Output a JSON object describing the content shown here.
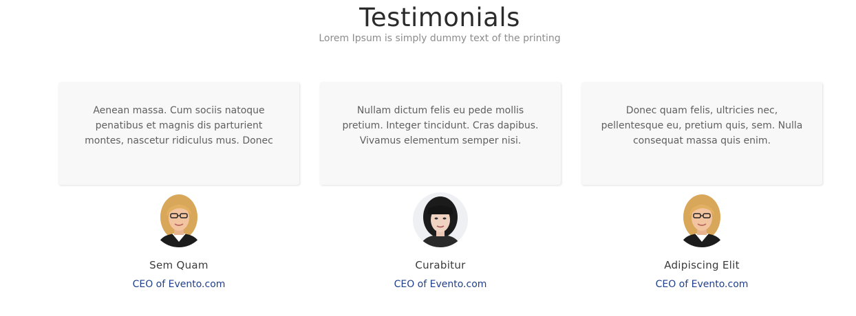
{
  "section": {
    "title": "Testimonials",
    "subtitle": "Lorem Ipsum is simply dummy text of the printing"
  },
  "testimonials": [
    {
      "quote": "Aenean massa. Cum sociis natoque penatibus et magnis dis parturient montes, nascetur ridiculus mus. Donec",
      "name": "Sem Quam",
      "role": "CEO of Evento.com",
      "avatar": "blonde-woman-glasses-photo"
    },
    {
      "quote": "Nullam dictum felis eu pede mollis pretium. Integer tincidunt. Cras dapibus. Vivamus elementum semper nisi.",
      "name": "Curabitur",
      "role": "CEO of Evento.com",
      "avatar": "dark-hair-woman-photo"
    },
    {
      "quote": "Donec quam felis, ultricies nec, pellentesque eu, pretium quis, sem. Nulla consequat massa quis enim.",
      "name": "Adipiscing Elit",
      "role": "CEO of Evento.com",
      "avatar": "blonde-woman-glasses-photo"
    }
  ],
  "colors": {
    "title": "#2b2b2b",
    "subtitle": "#8c8c8c",
    "card_background": "#f8f8f8",
    "link": "#1f3e8c"
  }
}
